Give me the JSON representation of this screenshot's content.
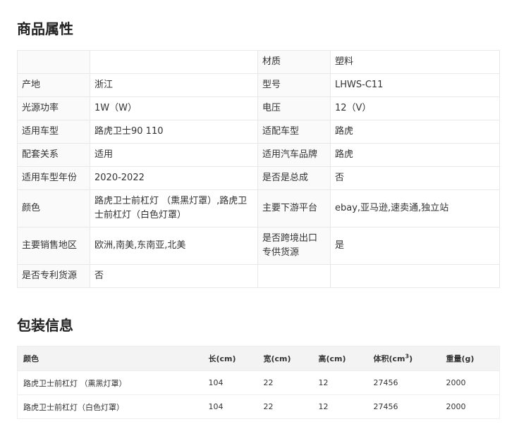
{
  "attributes": {
    "title": "商品属性",
    "rows": [
      [
        "",
        "",
        "材质",
        "塑料"
      ],
      [
        "产地",
        "浙江",
        "型号",
        "LHWS-C11"
      ],
      [
        "光源功率",
        "1W（W）",
        "电压",
        "12（V）"
      ],
      [
        "适用车型",
        "路虎卫士90 110",
        "适配车型",
        "路虎"
      ],
      [
        "配套关系",
        "适用",
        "适用汽车品牌",
        "路虎"
      ],
      [
        "适用车型年份",
        "2020-2022",
        "是否是总成",
        "否"
      ],
      [
        "颜色",
        "路虎卫士前杠灯 （熏黑灯罩）,路虎卫士前杠灯（白色灯罩）",
        "主要下游平台",
        "ebay,亚马逊,速卖通,独立站"
      ],
      [
        "主要销售地区",
        "欧洲,南美,东南亚,北美",
        "是否跨境出口专供货源",
        "是"
      ],
      [
        "是否专利货源",
        "否",
        "",
        ""
      ]
    ]
  },
  "packaging": {
    "title": "包装信息",
    "headers": [
      "颜色",
      "长(cm)",
      "宽(cm)",
      "高(cm)",
      "体积(cm",
      "重量(g)"
    ],
    "volume_superscript": "3",
    "volume_close": ")",
    "rows": [
      [
        "路虎卫士前杠灯 （熏黑灯罩）",
        "104",
        "22",
        "12",
        "27456",
        "2000"
      ],
      [
        "路虎卫士前杠灯（白色灯罩）",
        "104",
        "22",
        "12",
        "27456",
        "2000"
      ]
    ]
  }
}
